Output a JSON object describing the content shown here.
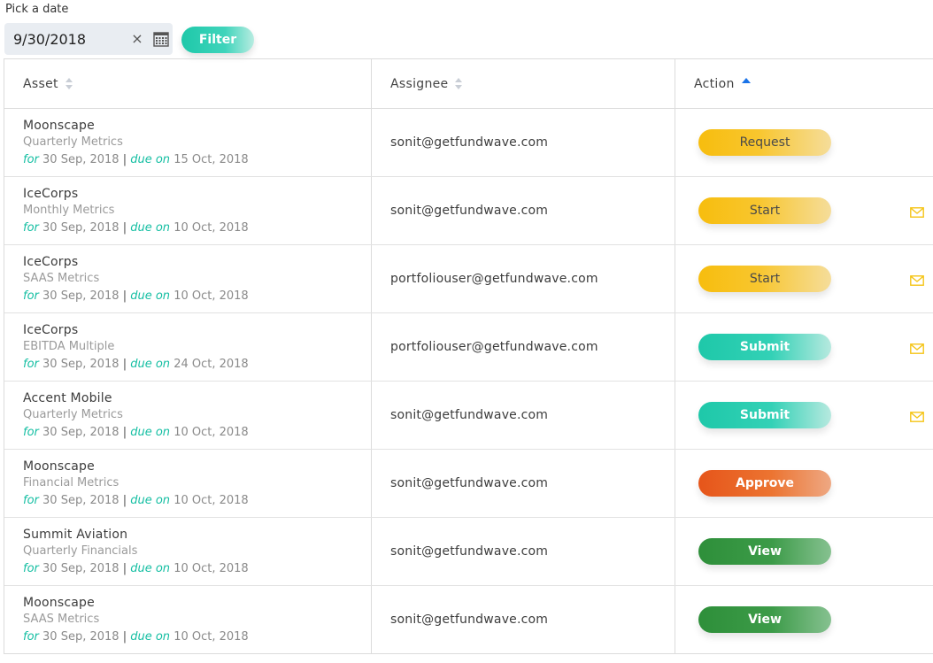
{
  "date_picker": {
    "label": "Pick a date",
    "value": "9/30/2018",
    "clear_glyph": "×",
    "calendar_icon": "calendar-icon"
  },
  "filter_button": {
    "label": "Filter"
  },
  "table": {
    "headers": {
      "asset": "Asset",
      "assignee": "Assignee",
      "action": "Action"
    },
    "sort": {
      "column": "action",
      "direction": "ascending"
    },
    "for_label": "for",
    "due_label": "due on",
    "separator": "|",
    "rows": [
      {
        "asset": "Moonscape",
        "type": "Quarterly Metrics",
        "for_date": "30 Sep, 2018",
        "due_date": "15 Oct, 2018",
        "assignee": "sonit@getfundwave.com",
        "action": "Request",
        "action_color": "yellow",
        "mail_icon": false
      },
      {
        "asset": "IceCorps",
        "type": "Monthly Metrics",
        "for_date": "30 Sep, 2018",
        "due_date": "10 Oct, 2018",
        "assignee": "sonit@getfundwave.com",
        "action": "Start",
        "action_color": "yellow",
        "mail_icon": true
      },
      {
        "asset": "IceCorps",
        "type": "SAAS Metrics",
        "for_date": "30 Sep, 2018",
        "due_date": "10 Oct, 2018",
        "assignee": "portfoliouser@getfundwave.com",
        "action": "Start",
        "action_color": "yellow",
        "mail_icon": true
      },
      {
        "asset": "IceCorps",
        "type": "EBITDA Multiple",
        "for_date": "30 Sep, 2018",
        "due_date": "24 Oct, 2018",
        "assignee": "portfoliouser@getfundwave.com",
        "action": "Submit",
        "action_color": "teal",
        "mail_icon": true
      },
      {
        "asset": "Accent Mobile",
        "type": "Quarterly Metrics",
        "for_date": "30 Sep, 2018",
        "due_date": "10 Oct, 2018",
        "assignee": "sonit@getfundwave.com",
        "action": "Submit",
        "action_color": "teal",
        "mail_icon": true
      },
      {
        "asset": "Moonscape",
        "type": "Financial Metrics",
        "for_date": "30 Sep, 2018",
        "due_date": "10 Oct, 2018",
        "assignee": "sonit@getfundwave.com",
        "action": "Approve",
        "action_color": "orange",
        "mail_icon": false
      },
      {
        "asset": "Summit Aviation",
        "type": "Quarterly Financials",
        "for_date": "30 Sep, 2018",
        "due_date": "10 Oct, 2018",
        "assignee": "sonit@getfundwave.com",
        "action": "View",
        "action_color": "green",
        "mail_icon": false
      },
      {
        "asset": "Moonscape",
        "type": "SAAS Metrics",
        "for_date": "30 Sep, 2018",
        "due_date": "10 Oct, 2018",
        "assignee": "sonit@getfundwave.com",
        "action": "View",
        "action_color": "green",
        "mail_icon": false
      }
    ]
  },
  "colors": {
    "accent_teal": "#1ec8a9",
    "yellow": "#f7bd0e",
    "orange": "#e6551a",
    "green": "#2e8f3a",
    "mail_icon": "#f5c518",
    "sort_active": "#1a73e8"
  }
}
